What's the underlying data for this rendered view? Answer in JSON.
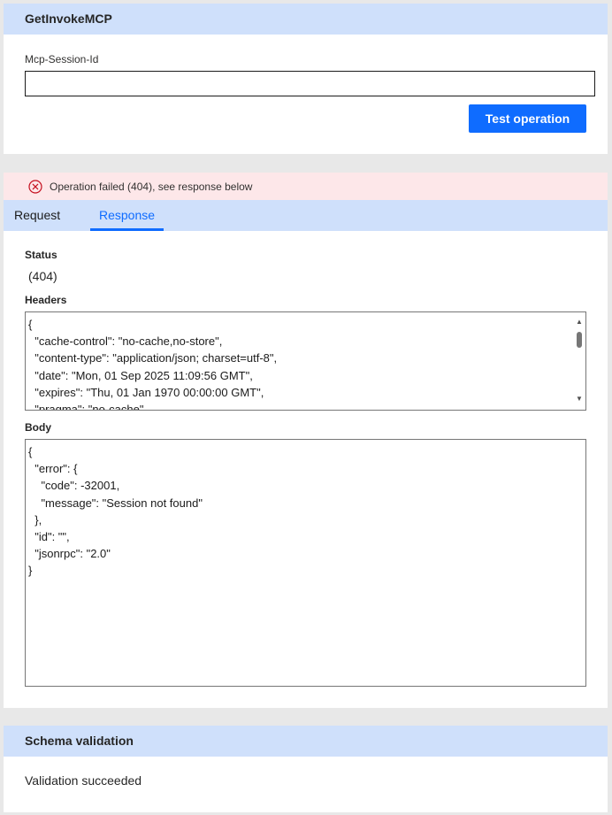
{
  "invoke_panel": {
    "title": "GetInvokeMCP",
    "field_label": "Mcp-Session-Id",
    "field_value": "",
    "button_label": "Test operation"
  },
  "response_panel": {
    "error_message": "Operation failed (404), see response below",
    "tabs": [
      {
        "label": "Request",
        "active": false
      },
      {
        "label": "Response",
        "active": true
      }
    ],
    "status_label": "Status",
    "status_value": "(404)",
    "headers_label": "Headers",
    "headers_text": "{\n  \"cache-control\": \"no-cache,no-store\",\n  \"content-type\": \"application/json; charset=utf-8\",\n  \"date\": \"Mon, 01 Sep 2025 11:09:56 GMT\",\n  \"expires\": \"Thu, 01 Jan 1970 00:00:00 GMT\",\n  \"pragma\": \"no-cache\"",
    "body_label": "Body",
    "body_text": "{\n  \"error\": {\n    \"code\": -32001,\n    \"message\": \"Session not found\"\n  },\n  \"id\": \"\",\n  \"jsonrpc\": \"2.0\"\n}"
  },
  "schema_panel": {
    "title": "Schema validation",
    "result": "Validation succeeded"
  },
  "colors": {
    "header_bg": "#cfe0fb",
    "primary": "#0f6cff",
    "error_bg": "#fde7e9",
    "error_icon": "#c50f1f"
  }
}
